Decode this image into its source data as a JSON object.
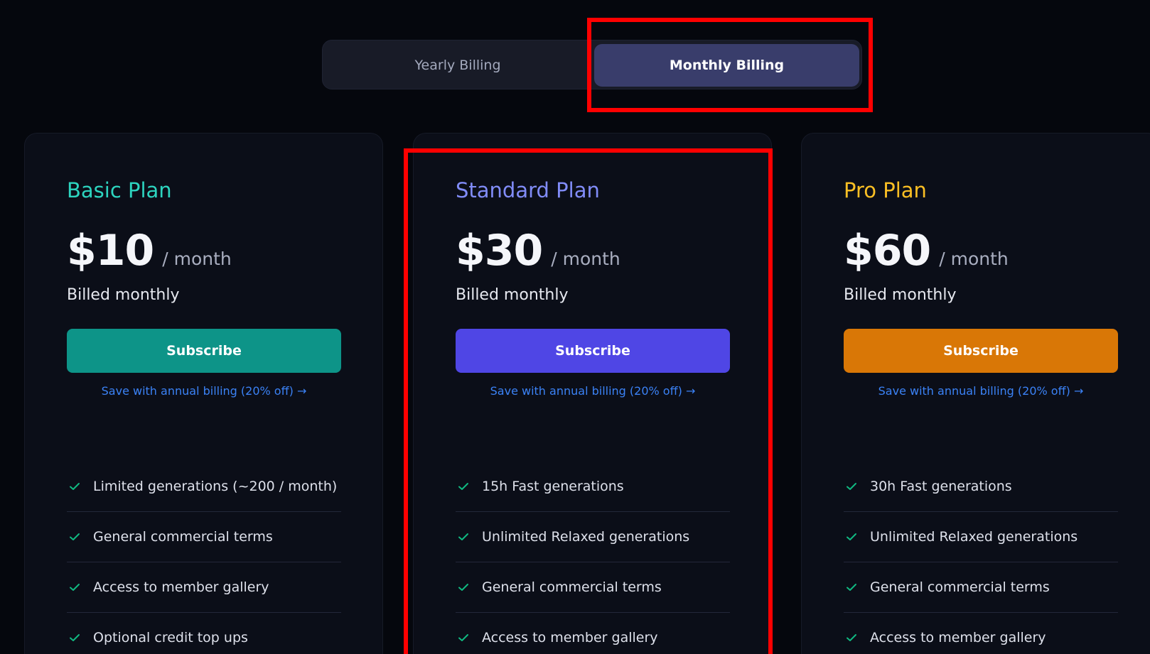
{
  "billing_toggle": {
    "yearly_label": "Yearly Billing",
    "monthly_label": "Monthly Billing",
    "selected": "monthly"
  },
  "plans": [
    {
      "name": "Basic Plan",
      "price": "$10",
      "period": "/ month",
      "billed": "Billed monthly",
      "button_label": "Subscribe",
      "save_link": "Save with annual billing (20% off) →",
      "accent_color": "#0d9488",
      "features": [
        "Limited generations (~200 / month)",
        "General commercial terms",
        "Access to member gallery",
        "Optional credit top ups"
      ]
    },
    {
      "name": "Standard Plan",
      "price": "$30",
      "period": "/ month",
      "billed": "Billed monthly",
      "button_label": "Subscribe",
      "save_link": "Save with annual billing (20% off) →",
      "accent_color": "#4f46e5",
      "features": [
        "15h Fast generations",
        "Unlimited Relaxed generations",
        "General commercial terms",
        "Access to member gallery"
      ]
    },
    {
      "name": "Pro Plan",
      "price": "$60",
      "period": "/ month",
      "billed": "Billed monthly",
      "button_label": "Subscribe",
      "save_link": "Save with annual billing (20% off) →",
      "accent_color": "#d97706",
      "features": [
        "30h Fast generations",
        "Unlimited Relaxed generations",
        "General commercial terms",
        "Access to member gallery"
      ]
    }
  ],
  "colors": {
    "background": "#05070d",
    "annotation": "#ff0000",
    "check": "#10b981"
  }
}
